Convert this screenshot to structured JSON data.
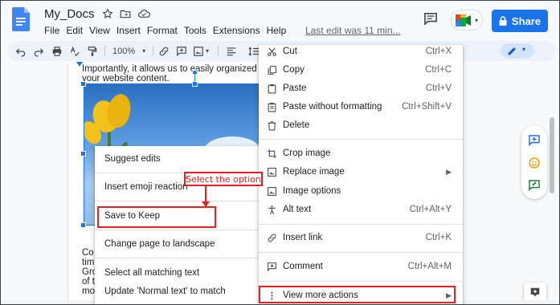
{
  "app": {
    "title": "My_Docs",
    "last_edit": "Last edit was 11 minutes ago",
    "last_edit_shown": "Last edit was 11 min...",
    "share_label": "Share",
    "accent": "#1a73e8"
  },
  "menubar": [
    "File",
    "Edit",
    "View",
    "Insert",
    "Format",
    "Tools",
    "Extensions",
    "Help"
  ],
  "toolbar": {
    "zoom": "100%",
    "icons": [
      "undo-icon",
      "redo-icon",
      "print-icon",
      "paint-format-icon",
      "link-icon",
      "add-comment-icon",
      "insert-image-icon",
      "line-spacing-icon",
      "edit-mode-pen-icon"
    ]
  },
  "page": {
    "line1": "Importantly, it allows us to easily organized and",
    "line2": "your website content.",
    "lines_after": [
      "Co",
      "tim",
      "Gro",
      "of t",
      "mo"
    ]
  },
  "left_menu": {
    "items": [
      {
        "label": "Suggest edits"
      },
      {
        "label": "Insert emoji reaction"
      },
      {
        "label": "Save to Keep"
      },
      {
        "label": "Change page to landscape"
      },
      {
        "label": "Select all matching text"
      },
      {
        "label": "Update 'Normal text' to match"
      }
    ]
  },
  "right_menu": {
    "items": [
      {
        "label": "Cut",
        "shortcut": "Ctrl+X",
        "icon": "cut-icon"
      },
      {
        "label": "Copy",
        "shortcut": "Ctrl+C",
        "icon": "copy-icon"
      },
      {
        "label": "Paste",
        "shortcut": "Ctrl+V",
        "icon": "paste-icon"
      },
      {
        "label": "Paste without formatting",
        "shortcut": "Ctrl+Shift+V",
        "icon": "paste-plain-icon"
      },
      {
        "label": "Delete",
        "shortcut": "",
        "icon": "trash-icon"
      },
      {
        "label": "Crop image",
        "shortcut": "",
        "icon": "crop-icon"
      },
      {
        "label": "Replace image",
        "shortcut": "",
        "icon": "replace-image-icon"
      },
      {
        "label": "Image options",
        "shortcut": "",
        "icon": "image-options-icon"
      },
      {
        "label": "Alt text",
        "shortcut": "Ctrl+Alt+Y",
        "icon": "accessibility-icon"
      },
      {
        "label": "Insert link",
        "shortcut": "Ctrl+K",
        "icon": "link-icon"
      },
      {
        "label": "Comment",
        "shortcut": "Ctrl+Alt+M",
        "icon": "add-comment-icon"
      },
      {
        "label": "View more actions",
        "shortcut": "",
        "icon": "more-vert-icon"
      }
    ]
  },
  "annotation": {
    "callout": "Select the option",
    "color": "#e5211f"
  }
}
